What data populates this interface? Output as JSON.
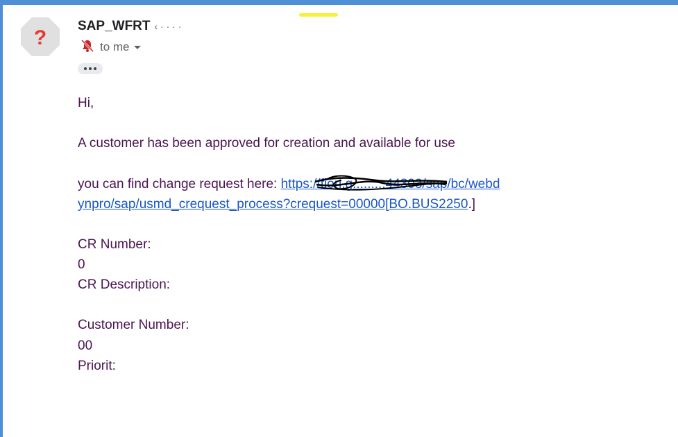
{
  "header": {
    "sender_name": "SAP_WFRT",
    "sender_email_visible": "‹      ·                  · ·  ·",
    "to_label": "to me",
    "more_label": "•••"
  },
  "message": {
    "greeting": "Hi,",
    "line1": "A customer has been approved for creation and available for use",
    "change_request_prefix": "you can find change request here: ",
    "link_line1": "https://fiori.g........:44303/sap/bc/webd",
    "link_line2": "ynpro/sap/usmd_crequest_process?crequest=00000[BO.BUS2250",
    "link_suffix": ".]",
    "cr_number_label": "CR Number:",
    "cr_number_value": "0",
    "cr_description_label": "CR Description:",
    "customer_number_label": "Customer Number:",
    "customer_number_value": "00",
    "priority_label": "Priorit:"
  },
  "colors": {
    "frame": "#4f8fd6",
    "body_text": "#4a1450",
    "link": "#1a56c8",
    "avatar_bg": "#e0e0e0",
    "avatar_mark": "#e53935"
  },
  "icons": {
    "avatar": "unknown-sender-question-icon",
    "to_me": "mute-notification-icon",
    "dropdown": "chevron-down-icon"
  }
}
